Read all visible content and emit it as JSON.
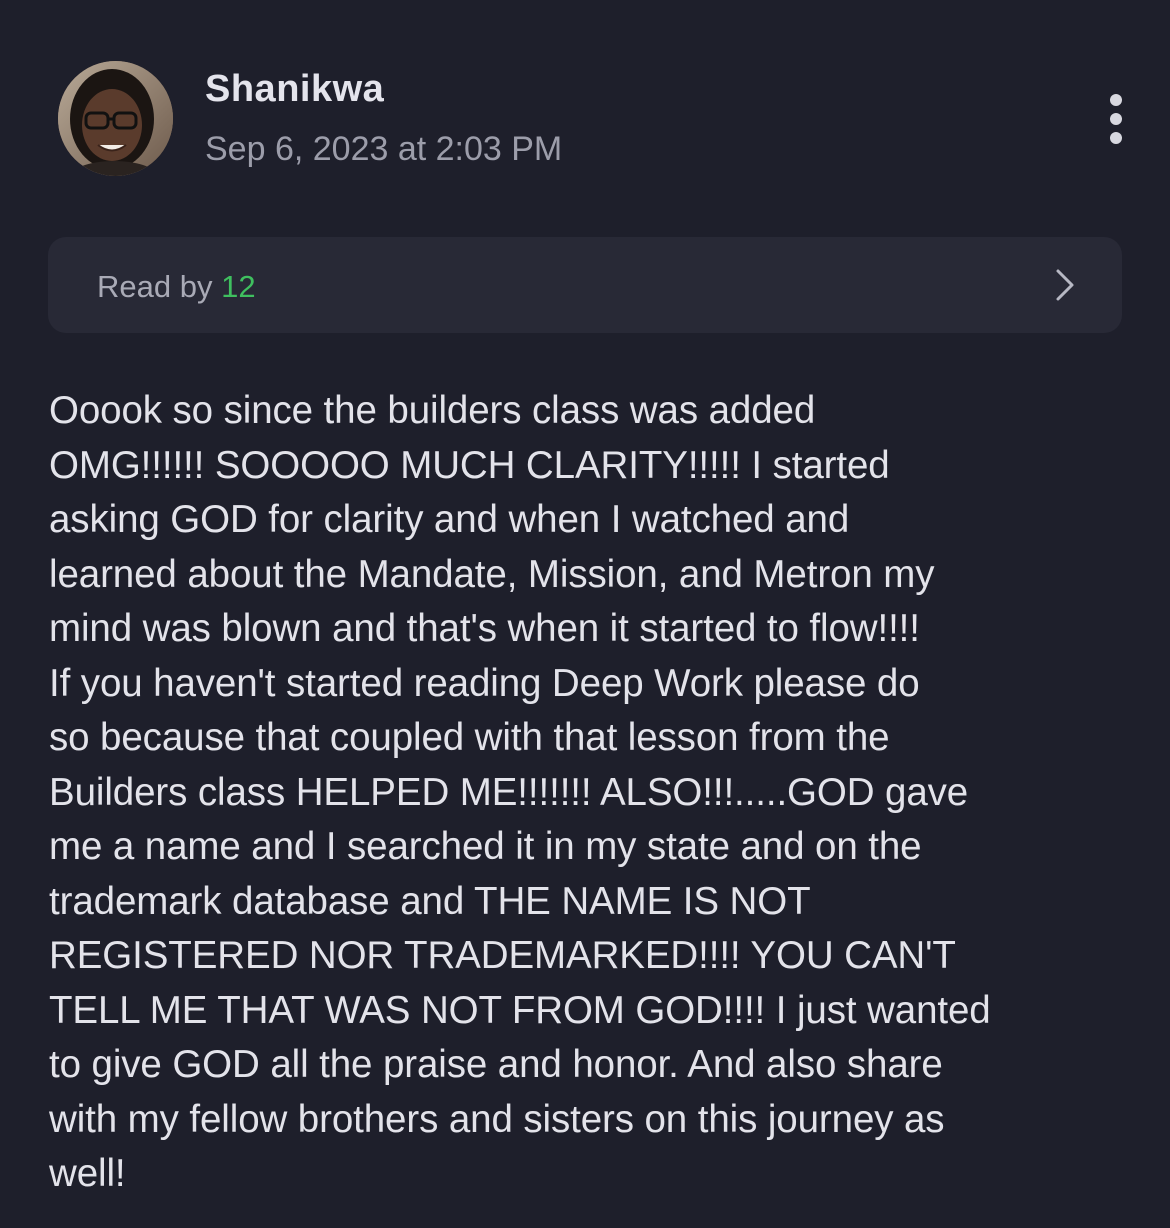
{
  "post": {
    "author": {
      "name": "Shanikwa",
      "avatar_icon": "user-avatar-photo"
    },
    "timestamp": "Sep 6, 2023 at 2:03 PM",
    "more_icon": "vertical-ellipsis-icon",
    "read_by": {
      "label": "Read by",
      "count": "12",
      "count_color": "#3fbf5f",
      "chevron_icon": "chevron-right-icon"
    },
    "body_lines": [
      "Ooook so since the builders class was added",
      "OMG!!!!!! SOOOOO MUCH CLARITY!!!!! I started",
      "asking GOD for clarity and when I watched and",
      "learned about the Mandate, Mission, and Metron my",
      "mind was blown and that's when it started to flow!!!!",
      "If you haven't started reading Deep Work please do",
      "so because that coupled with that lesson from the",
      "Builders class HELPED ME!!!!!!! ALSO!!!.....GOD gave",
      "me a name and I searched it in my state and on the",
      "trademark database and THE NAME IS NOT",
      "REGISTERED NOR TRADEMARKED!!!! YOU CAN'T",
      "TELL ME THAT WAS NOT FROM GOD!!!! I just wanted",
      "to give GOD all the praise and honor. And also share",
      "with my fellow brothers and sisters on this journey as",
      "well!"
    ]
  },
  "colors": {
    "background": "#1e1f2b",
    "card": "#282936",
    "text_primary": "#e3e3ea",
    "text_secondary": "#9c9daa",
    "accent_green": "#3fbf5f"
  }
}
